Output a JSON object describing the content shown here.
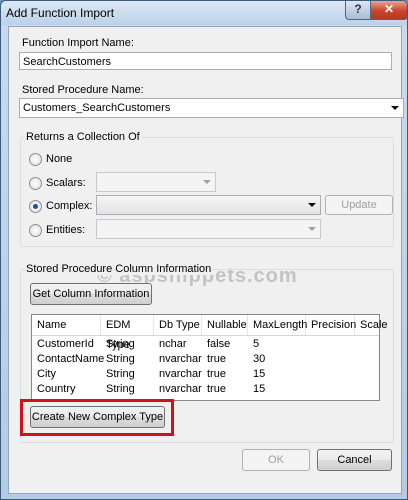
{
  "window": {
    "title": "Add Function Import",
    "help_glyph": "?",
    "close_glyph": "✕"
  },
  "function_import": {
    "label": "Function Import Name:",
    "value": "SearchCustomers"
  },
  "stored_procedure": {
    "label": "Stored Procedure Name:",
    "value": "Customers_SearchCustomers"
  },
  "returns": {
    "legend": "Returns a Collection Of",
    "options": [
      {
        "label": "None",
        "checked": false
      },
      {
        "label": "Scalars:",
        "checked": false
      },
      {
        "label": "Complex:",
        "checked": true
      },
      {
        "label": "Entities:",
        "checked": false
      }
    ],
    "update_button": "Update"
  },
  "watermark": "© aspsnippets.com",
  "column_info": {
    "legend": "Stored Procedure Column Information",
    "get_button": "Get Column Information",
    "headers": [
      "Name",
      "EDM Type",
      "Db Type",
      "Nullable",
      "MaxLength",
      "Precision",
      "Scale"
    ],
    "rows": [
      [
        "CustomerId",
        "String",
        "nchar",
        "false",
        "5"
      ],
      [
        "ContactName",
        "String",
        "nvarchar",
        "true",
        "30"
      ],
      [
        "City",
        "String",
        "nvarchar",
        "true",
        "15"
      ],
      [
        "Country",
        "String",
        "nvarchar",
        "true",
        "15"
      ]
    ],
    "create_button": "Create New Complex Type"
  },
  "footer": {
    "ok": "OK",
    "cancel": "Cancel"
  },
  "colors": {
    "highlight": "#d2121b",
    "titlebar": "#bcd1e8"
  }
}
